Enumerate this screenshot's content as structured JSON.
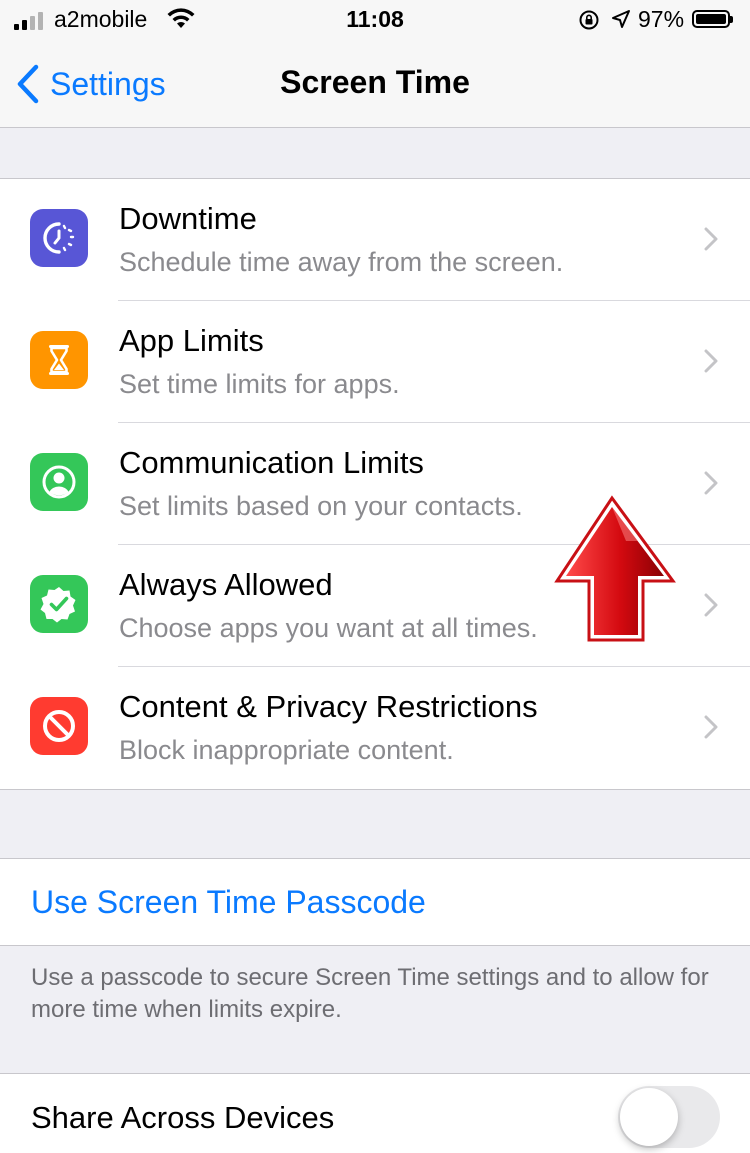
{
  "status_bar": {
    "carrier": "a2mobile",
    "time": "11:08",
    "battery_percent": "97%"
  },
  "nav": {
    "back_label": "Settings",
    "title": "Screen Time"
  },
  "menu": {
    "items": [
      {
        "title": "Downtime",
        "subtitle": "Schedule time away from the screen.",
        "icon": "downtime-icon",
        "color": "#5856d6"
      },
      {
        "title": "App Limits",
        "subtitle": "Set time limits for apps.",
        "icon": "hourglass-icon",
        "color": "#ff9500"
      },
      {
        "title": "Communication Limits",
        "subtitle": "Set limits based on your contacts.",
        "icon": "person-circle-icon",
        "color": "#34c759"
      },
      {
        "title": "Always Allowed",
        "subtitle": "Choose apps you want at all times.",
        "icon": "checkmark-seal-icon",
        "color": "#34c759"
      },
      {
        "title": "Content & Privacy Restrictions",
        "subtitle": "Block inappropriate content.",
        "icon": "restricted-icon",
        "color": "#ff3b30"
      }
    ]
  },
  "passcode": {
    "link_label": "Use Screen Time Passcode",
    "footnote": "Use a passcode to secure Screen Time settings and to allow for more time when limits expire."
  },
  "share": {
    "label": "Share Across Devices",
    "enabled": false
  },
  "colors": {
    "accent": "#0a7aff",
    "annotation_arrow": "#e0141a"
  }
}
